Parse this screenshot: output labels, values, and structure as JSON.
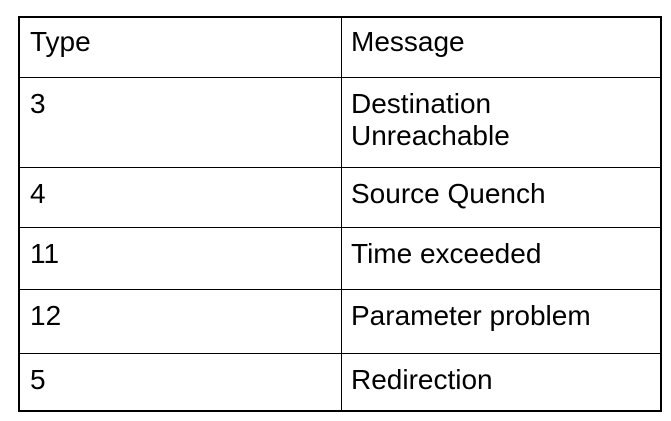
{
  "table": {
    "headers": [
      "Type",
      "Message"
    ],
    "rows": [
      {
        "type": "3",
        "message_line1": "Destination",
        "message_line2": "Unreachable"
      },
      {
        "type": "4",
        "message_line1": "Source Quench"
      },
      {
        "type": "11",
        "message_line1": "Time exceeded"
      },
      {
        "type": "12",
        "message_line1": "Parameter problem"
      },
      {
        "type": "5",
        "message_line1": "Redirection"
      }
    ]
  },
  "colors": {
    "border": "#000000",
    "text": "#000000",
    "background": "#ffffff"
  }
}
